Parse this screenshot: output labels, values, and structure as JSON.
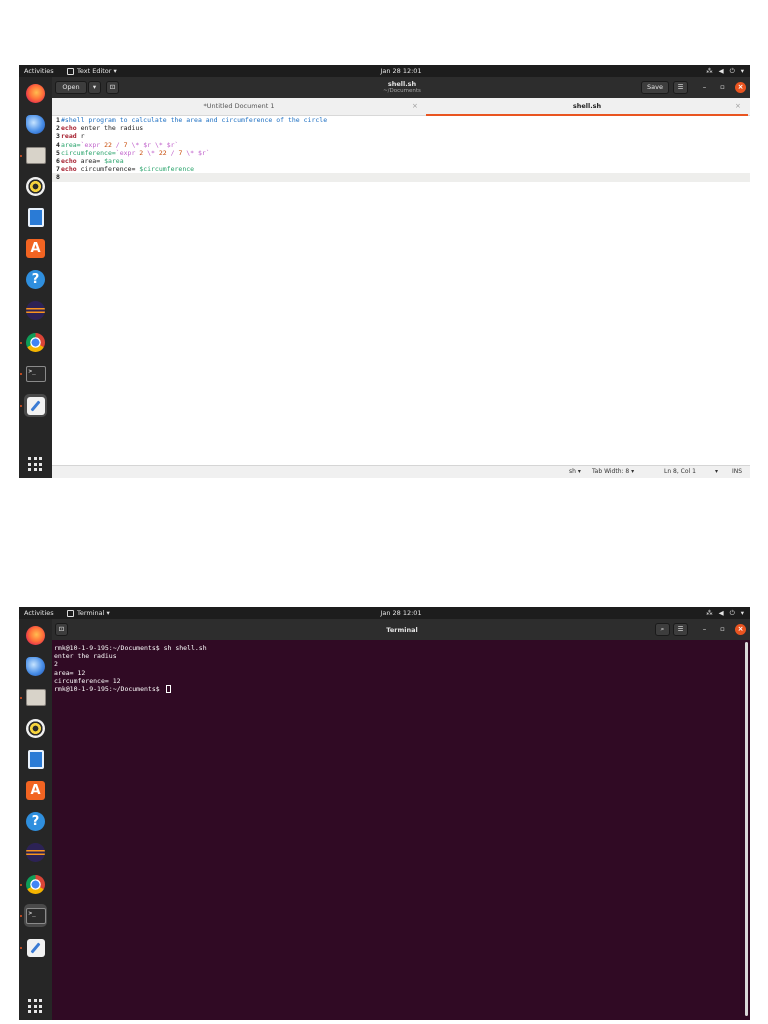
{
  "screen1": {
    "topbar": {
      "activities": "Activities",
      "app": "Text Editor ▾",
      "clock": "Jan 28  12:01",
      "tray": [
        "network-icon",
        "volume-icon",
        "power-icon",
        "chevron-down-icon"
      ]
    },
    "header": {
      "open_label": "Open",
      "title": "shell.sh",
      "subtitle": "~/Documents",
      "save_label": "Save"
    },
    "tabs": [
      {
        "label": "*Untitled Document 1",
        "active": false
      },
      {
        "label": "shell.sh",
        "active": true
      }
    ],
    "code": [
      {
        "n": "1",
        "parts": [
          {
            "c": "t-comment",
            "t": "#shell program to calculate the area and circumference of the circle"
          }
        ]
      },
      {
        "n": "2",
        "parts": [
          {
            "c": "t-kw",
            "t": "echo"
          },
          {
            "c": "t-plain",
            "t": " enter the radius"
          }
        ]
      },
      {
        "n": "3",
        "parts": [
          {
            "c": "t-kw",
            "t": "read"
          },
          {
            "c": "t-plain",
            "t": " r"
          }
        ]
      },
      {
        "n": "4",
        "parts": [
          {
            "c": "t-var",
            "t": "area="
          },
          {
            "c": "t-str",
            "t": "`expr "
          },
          {
            "c": "t-num",
            "t": "22"
          },
          {
            "c": "t-str",
            "t": " / "
          },
          {
            "c": "t-num",
            "t": "7"
          },
          {
            "c": "t-str",
            "t": " \\* $r \\* $r`"
          }
        ]
      },
      {
        "n": "5",
        "parts": [
          {
            "c": "t-var",
            "t": "circumference="
          },
          {
            "c": "t-str",
            "t": "`expr "
          },
          {
            "c": "t-num",
            "t": "2"
          },
          {
            "c": "t-str",
            "t": " \\* "
          },
          {
            "c": "t-num",
            "t": "22"
          },
          {
            "c": "t-str",
            "t": " / "
          },
          {
            "c": "t-num",
            "t": "7"
          },
          {
            "c": "t-str",
            "t": " \\* $r`"
          }
        ]
      },
      {
        "n": "6",
        "parts": [
          {
            "c": "t-kw",
            "t": "echo"
          },
          {
            "c": "t-plain",
            "t": " area= "
          },
          {
            "c": "t-var",
            "t": "$area"
          }
        ]
      },
      {
        "n": "7",
        "parts": [
          {
            "c": "t-kw",
            "t": "echo"
          },
          {
            "c": "t-plain",
            "t": " circumference= "
          },
          {
            "c": "t-var",
            "t": "$circumference"
          }
        ]
      },
      {
        "n": "8",
        "parts": [],
        "current": true
      }
    ],
    "status": {
      "lang": "sh ▾",
      "tab_width": "Tab Width: 8 ▾",
      "position": "Ln 8, Col 1",
      "mode_arrow": "▾",
      "ins": "INS"
    }
  },
  "screen2": {
    "topbar": {
      "activities": "Activities",
      "app": "Terminal ▾",
      "clock": "Jan 28  12:01"
    },
    "header": {
      "title": "Terminal"
    },
    "lines": [
      "rmk@10-1-9-195:~/Documents$ sh shell.sh",
      "enter the radius",
      "2",
      "area= 12",
      "circumference= 12"
    ],
    "prompt": "rmk@10-1-9-195:~/Documents$ "
  },
  "dock": [
    "firefox-icon",
    "thunderbird-icon",
    "files-icon",
    "rhythmbox-icon",
    "libreoffice-writer-icon",
    "software-store-icon",
    "help-icon",
    "eclipse-icon",
    "chrome-icon",
    "terminal-icon",
    "text-editor-icon"
  ],
  "colors": {
    "accent": "#e95420",
    "terminal_bg": "#300a24"
  }
}
